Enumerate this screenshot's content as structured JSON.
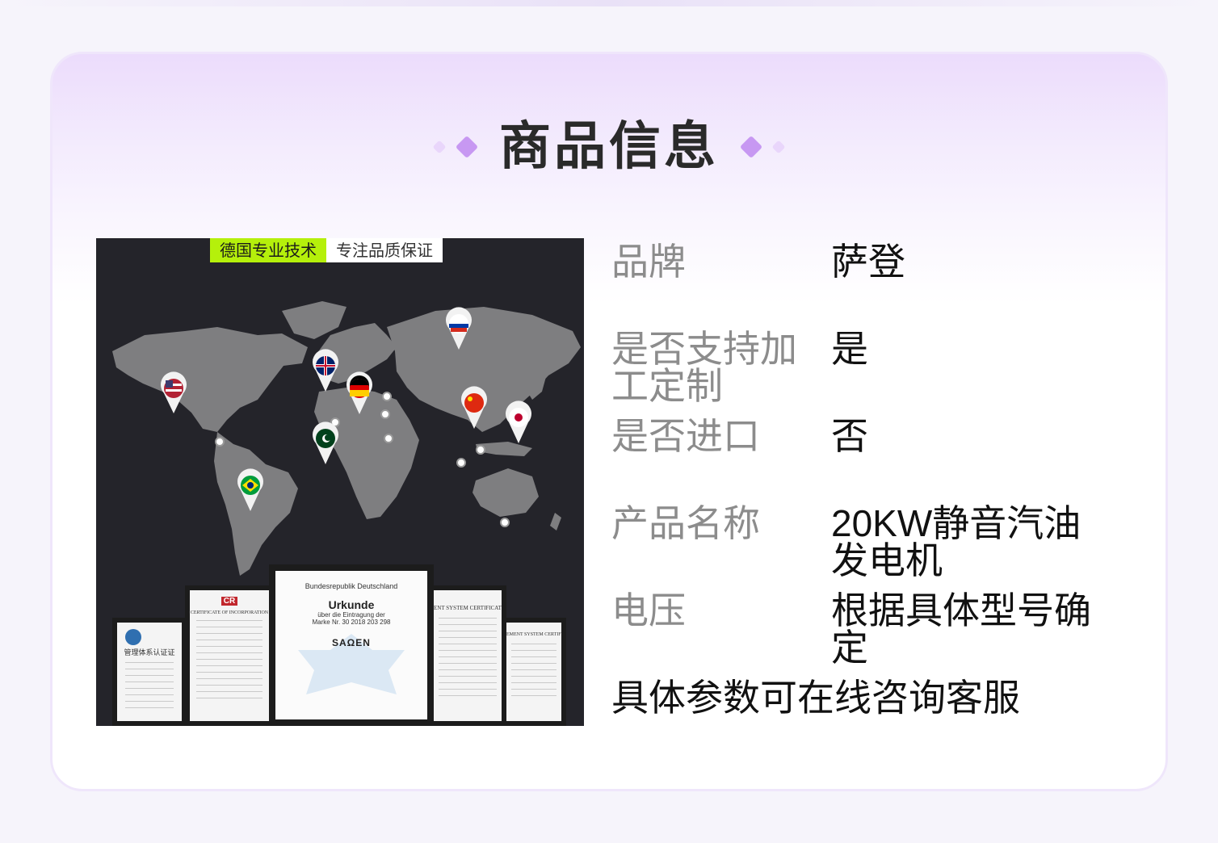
{
  "section_title": "商品信息",
  "image_panel": {
    "banner_left": "德国专业技术",
    "banner_right": "专注品质保证",
    "flags": [
      "usa-flag",
      "uk-flag",
      "germany-flag",
      "russia-flag",
      "china-flag",
      "japan-flag",
      "brazil-flag",
      "pakistan-flag"
    ],
    "certificates": {
      "left_cert": "管理体系认证证",
      "cr_cert_title": "CERTIFICATE OF INCORPORATION",
      "cr_logo": "CR",
      "main_header": "Bundesrepublik Deutschland",
      "main_title": "Urkunde",
      "main_line1": "über die Eintragung der",
      "main_line2": "Marke Nr. 30 2018 203 298",
      "main_brand": "SAΩEN",
      "right_cert_title": "ENT SYSTEM CERTIFICATE",
      "far_right_title": "EMENT SYSTEM CERTIFICATE"
    }
  },
  "specs": [
    {
      "label": "品牌",
      "value": "萨登"
    },
    {
      "label": "是否支持加工定制",
      "value": "是"
    },
    {
      "label": "是否进口",
      "value": "否"
    },
    {
      "label": "产品名称",
      "value": "20KW静音汽油发电机"
    },
    {
      "label": "电压",
      "value": "根据具体型号确定"
    }
  ],
  "footer_note": "具体参数可在线咨询客服",
  "colors": {
    "accent_green": "#b5f00b",
    "diamond_purple": "#c798f2",
    "card_gradient_top": "#ecdcfc",
    "label_gray": "#8c8c8c"
  }
}
